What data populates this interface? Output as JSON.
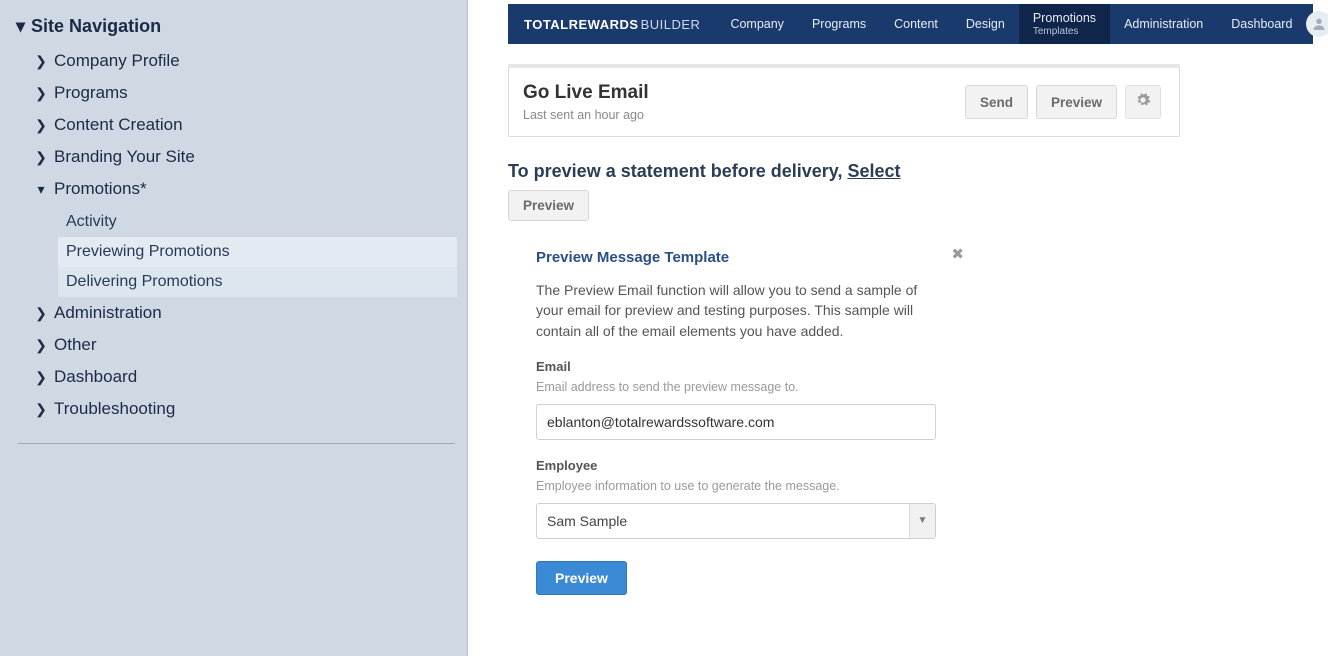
{
  "sidebar": {
    "title": "Site Navigation",
    "items": [
      {
        "label": "Company Profile",
        "expanded": false
      },
      {
        "label": "Programs",
        "expanded": false
      },
      {
        "label": "Content Creation",
        "expanded": false
      },
      {
        "label": "Branding Your Site",
        "expanded": false
      },
      {
        "label": "Promotions*",
        "expanded": true,
        "children": [
          {
            "label": "Activity",
            "state": "normal"
          },
          {
            "label": "Previewing Promotions",
            "state": "active"
          },
          {
            "label": "Delivering Promotions",
            "state": "hover"
          }
        ]
      },
      {
        "label": "Administration",
        "expanded": false
      },
      {
        "label": "Other",
        "expanded": false
      },
      {
        "label": "Dashboard",
        "expanded": false
      },
      {
        "label": "Troubleshooting",
        "expanded": false
      }
    ]
  },
  "topbar": {
    "brand_bold": "TOTALREWARDS",
    "brand_thin": "BUILDER",
    "tabs": [
      {
        "label": "Company"
      },
      {
        "label": "Programs"
      },
      {
        "label": "Content"
      },
      {
        "label": "Design"
      },
      {
        "label": "Promotions",
        "sub": "Templates",
        "active": true
      },
      {
        "label": "Administration"
      },
      {
        "label": "Dashboard"
      }
    ]
  },
  "card": {
    "title": "Go Live Email",
    "subtitle": "Last sent an hour ago",
    "send_label": "Send",
    "preview_label": "Preview",
    "gear_icon": "gear"
  },
  "intro": {
    "text_prefix": "To preview a statement before delivery, ",
    "select_label": "Select ",
    "preview_label": "Preview"
  },
  "panel": {
    "title": "Preview Message Template",
    "description": "The Preview Email function will allow you to send a sample of your email for preview and testing purposes. This sample will contain all of the email elements you have added.",
    "email_label": "Email",
    "email_help": "Email address to send the preview message to.",
    "email_value": "eblanton@totalrewardssoftware.com",
    "employee_label": "Employee",
    "employee_help": "Employee information to use to generate the message.",
    "employee_value": "Sam Sample",
    "preview_button": "Preview"
  }
}
